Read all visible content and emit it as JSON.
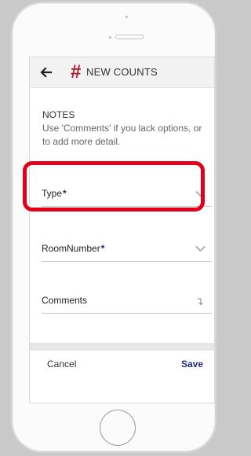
{
  "header": {
    "title": "NEW COUNTS",
    "hash_glyph": "#",
    "back_icon": "arrow-left-icon"
  },
  "notes": {
    "heading": "NOTES",
    "text": "Use 'Comments' if you lack options, or to add more detail."
  },
  "fields": [
    {
      "label": "Type",
      "required_mark": "*",
      "icon": "chevron-down-icon",
      "value": ""
    },
    {
      "label": "RoomNumber",
      "required_mark": "*",
      "icon": "chevron-down-icon",
      "value": ""
    },
    {
      "label": "Comments",
      "required_mark": "",
      "icon": "enter-icon",
      "value": ""
    }
  ],
  "footer": {
    "cancel_label": "Cancel",
    "save_label": "Save"
  },
  "colors": {
    "accent": "#b3162b",
    "link": "#1b2a7a",
    "highlight": "#e1001c"
  }
}
